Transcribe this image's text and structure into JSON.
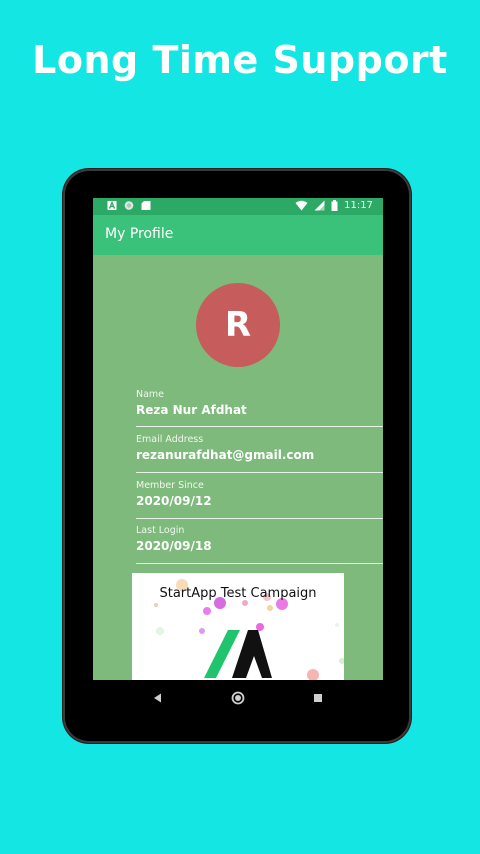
{
  "promo": {
    "title": "Long Time Support"
  },
  "status_bar": {
    "time": "11:17",
    "left_icons": [
      "app-notification-icon",
      "circle-notification-icon",
      "sd-card-icon"
    ],
    "right_icons": [
      "wifi-icon",
      "signal-icon",
      "battery-icon"
    ]
  },
  "app_bar": {
    "title": "My Profile"
  },
  "profile": {
    "avatar_letter": "R",
    "avatar_color": "#c65c5b",
    "fields": [
      {
        "label": "Name",
        "value": "Reza Nur Afdhat"
      },
      {
        "label": "Email Address",
        "value": "rezanurafdhat@gmail.com"
      },
      {
        "label": "Member Since",
        "value": "2020/09/12"
      },
      {
        "label": "Last Login",
        "value": "2020/09/18"
      }
    ]
  },
  "ad": {
    "title": "StartApp Test Campaign"
  },
  "nav": {
    "buttons": [
      "back-icon",
      "home-icon",
      "recents-icon"
    ]
  },
  "colors": {
    "background": "#14e6e3",
    "app_bar": "#3ac17a",
    "status_bar": "#2ba965",
    "content": "#7dba7b"
  }
}
